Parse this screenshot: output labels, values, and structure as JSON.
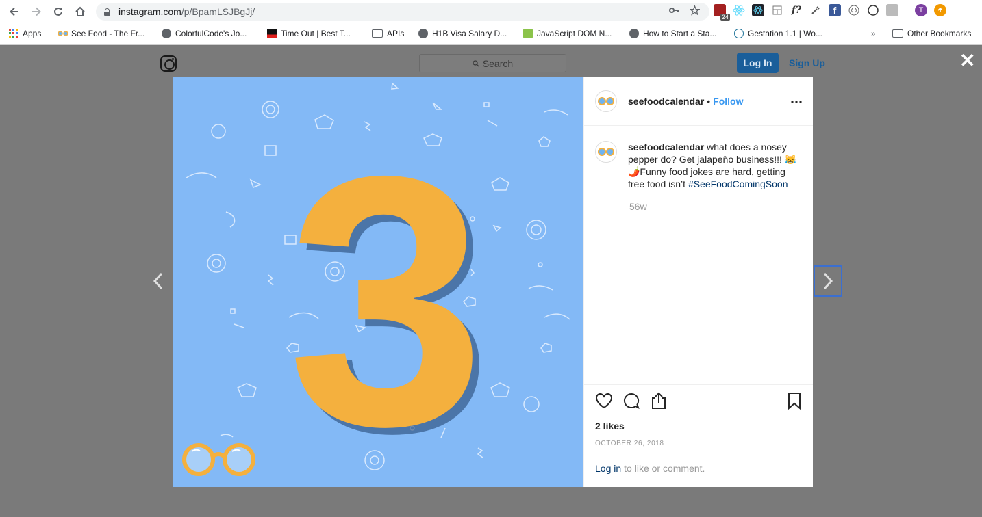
{
  "browser": {
    "url_host": "instagram.com",
    "url_path": "/p/BpamLSJBgJj/",
    "ext_badge": "24",
    "ext_f_label": "f?",
    "profile_initial": "T"
  },
  "bookmarks": [
    {
      "label": "Apps"
    },
    {
      "label": "See Food - The Fr..."
    },
    {
      "label": "ColorfulCode's Jo..."
    },
    {
      "label": "Time Out | Best T..."
    },
    {
      "label": "APIs"
    },
    {
      "label": "H1B Visa Salary D..."
    },
    {
      "label": "JavaScript DOM N..."
    },
    {
      "label": "How to Start a Sta..."
    },
    {
      "label": "Gestation 1.1 | Wo..."
    },
    {
      "label": "Other Bookmarks"
    }
  ],
  "bookmarks_overflow": "»",
  "ig": {
    "search_placeholder": "Search",
    "login_label": "Log In",
    "signup_label": "Sign Up"
  },
  "post": {
    "username": "seefoodcalendar",
    "follow_label": "Follow",
    "dot": "•",
    "caption": "what does a nosey pepper do? Get jalapeño business!!! 😹🌶️Funny food jokes are hard, getting free food isn’t ",
    "hashtag": "#SeeFoodComingSoon",
    "time_ago": "56w",
    "likes": "2 likes",
    "date": "OCTOBER 26, 2018",
    "login_link": "Log in",
    "login_suffix": "to like or comment.",
    "media_numeral": "3"
  },
  "colors": {
    "media_bg": "#83b9f6",
    "numeral": "#f4b03e",
    "accent_link": "#3897f0"
  }
}
